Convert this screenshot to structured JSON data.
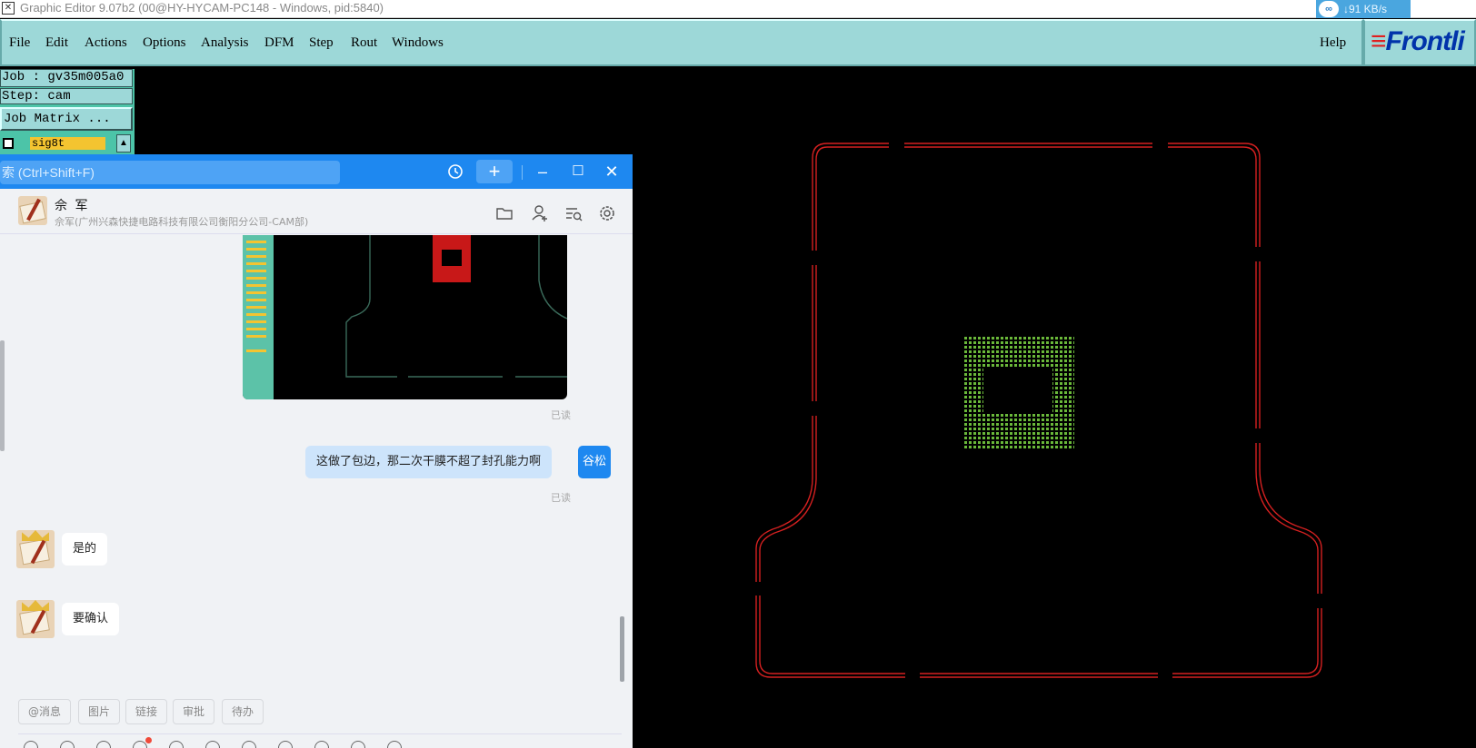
{
  "window": {
    "title": "Graphic Editor 9.07b2 (00@HY-HYCAM-PC148 - Windows, pid:5840)",
    "icon": "x-window-icon"
  },
  "net_monitor": {
    "speed": "91 KB/s",
    "icon": "cloud-icon"
  },
  "menubar": {
    "items": [
      "File",
      "Edit",
      "Actions",
      "Options",
      "Analysis",
      "DFM",
      "Step",
      "Rout",
      "Windows"
    ],
    "help": "Help"
  },
  "logo": {
    "text": "Frontli",
    "mark": "≡"
  },
  "job_panel": {
    "job": "Job : gv35m005a0",
    "step": "Step: cam",
    "matrix_button": "Job Matrix ...",
    "layer": "sig8t"
  },
  "chat": {
    "search_placeholder": "索 (Ctrl+Shift+F)",
    "contact": {
      "name": "佘 军",
      "org": "佘军(广州兴森快捷电路科技有限公司衡阳分公司-CAM部)"
    },
    "messages": [
      {
        "from": "me",
        "type": "image",
        "status": "已读"
      },
      {
        "from": "me",
        "type": "text",
        "text": "这做了包边，那二次干膜不超了封孔能力啊",
        "avatar_text": "谷松",
        "status": "已读"
      },
      {
        "from": "other",
        "type": "text",
        "text": "是的"
      },
      {
        "from": "other",
        "type": "text",
        "text": "要确认"
      }
    ],
    "quick_actions": [
      "@消息",
      "图片",
      "链接",
      "审批",
      "待办"
    ]
  },
  "colors": {
    "menu_bg": "#9dd8d8",
    "profile_red": "#d42020",
    "pad_green": "#6ab83a",
    "chat_blue": "#1e88f0"
  }
}
